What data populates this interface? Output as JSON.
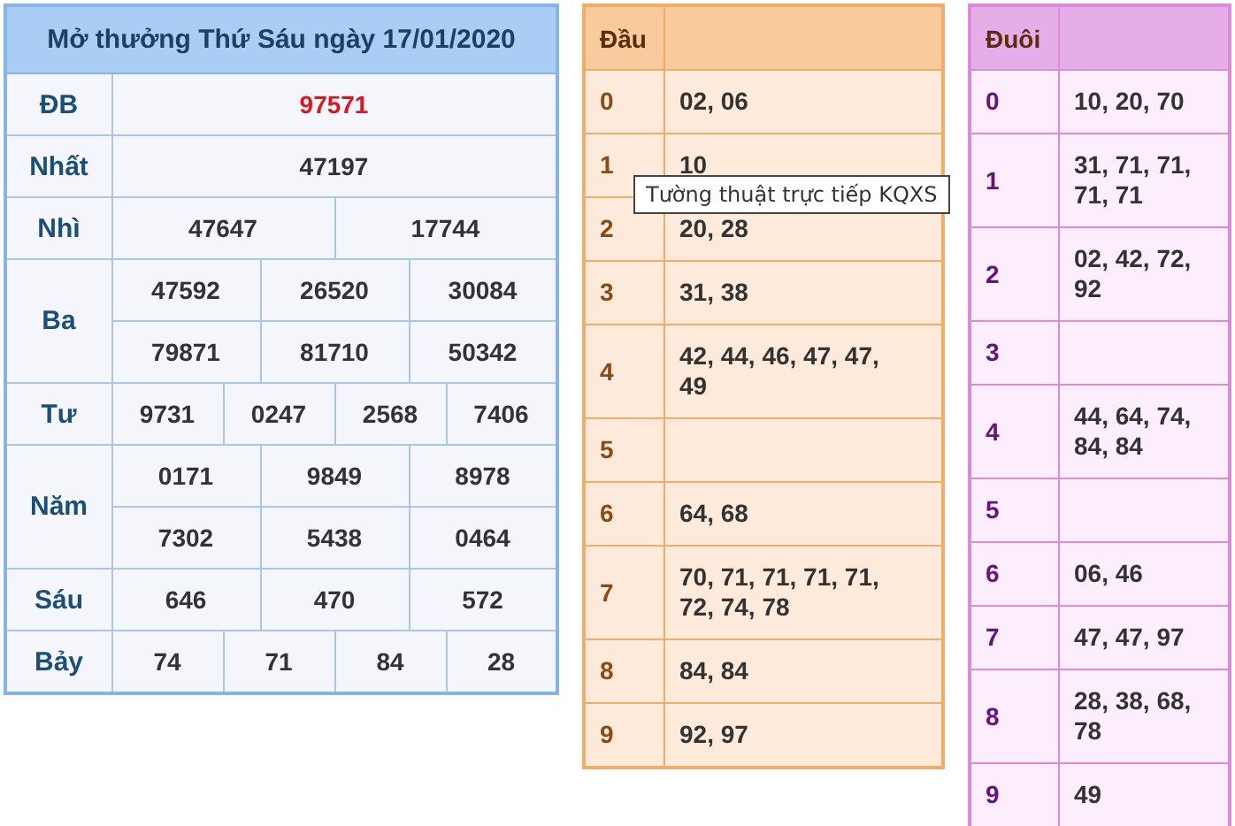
{
  "results": {
    "title": "Mở thưởng Thứ Sáu ngày 17/01/2020",
    "prizes": [
      {
        "label": "ĐB",
        "kind": "special",
        "rows": [
          [
            "97571"
          ]
        ]
      },
      {
        "label": "Nhất",
        "kind": "normal",
        "rows": [
          [
            "47197"
          ]
        ]
      },
      {
        "label": "Nhì",
        "kind": "normal",
        "rows": [
          [
            "47647",
            "17744"
          ]
        ]
      },
      {
        "label": "Ba",
        "kind": "normal",
        "rows": [
          [
            "47592",
            "26520",
            "30084"
          ],
          [
            "79871",
            "81710",
            "50342"
          ]
        ]
      },
      {
        "label": "Tư",
        "kind": "normal",
        "rows": [
          [
            "9731",
            "0247",
            "2568",
            "7406"
          ]
        ]
      },
      {
        "label": "Năm",
        "kind": "normal",
        "rows": [
          [
            "0171",
            "9849",
            "8978"
          ],
          [
            "7302",
            "5438",
            "0464"
          ]
        ]
      },
      {
        "label": "Sáu",
        "kind": "normal",
        "rows": [
          [
            "646",
            "470",
            "572"
          ]
        ]
      },
      {
        "label": "Bảy",
        "kind": "normal",
        "rows": [
          [
            "74",
            "71",
            "84",
            "28"
          ]
        ]
      }
    ]
  },
  "heads": {
    "header": "Đầu",
    "rows": [
      {
        "digit": "0",
        "numbers": "02, 06"
      },
      {
        "digit": "1",
        "numbers": "10"
      },
      {
        "digit": "2",
        "numbers": "20, 28"
      },
      {
        "digit": "3",
        "numbers": "31, 38"
      },
      {
        "digit": "4",
        "numbers": "42, 44, 46, 47, 47, 49"
      },
      {
        "digit": "5",
        "numbers": ""
      },
      {
        "digit": "6",
        "numbers": "64, 68"
      },
      {
        "digit": "7",
        "numbers": "70, 71, 71, 71, 71, 72, 74, 78"
      },
      {
        "digit": "8",
        "numbers": "84, 84"
      },
      {
        "digit": "9",
        "numbers": "92, 97"
      }
    ]
  },
  "tails": {
    "header": "Đuôi",
    "rows": [
      {
        "digit": "0",
        "numbers": "10, 20, 70"
      },
      {
        "digit": "1",
        "numbers": "31, 71, 71, 71, 71"
      },
      {
        "digit": "2",
        "numbers": "02, 42, 72, 92"
      },
      {
        "digit": "3",
        "numbers": ""
      },
      {
        "digit": "4",
        "numbers": "44, 64, 74, 84, 84"
      },
      {
        "digit": "5",
        "numbers": ""
      },
      {
        "digit": "6",
        "numbers": "06, 46"
      },
      {
        "digit": "7",
        "numbers": "47, 47, 97"
      },
      {
        "digit": "8",
        "numbers": "28, 38, 68, 78"
      },
      {
        "digit": "9",
        "numbers": "49"
      }
    ]
  },
  "tooltip": {
    "text": "Tường thuật trực tiếp KQXS"
  }
}
